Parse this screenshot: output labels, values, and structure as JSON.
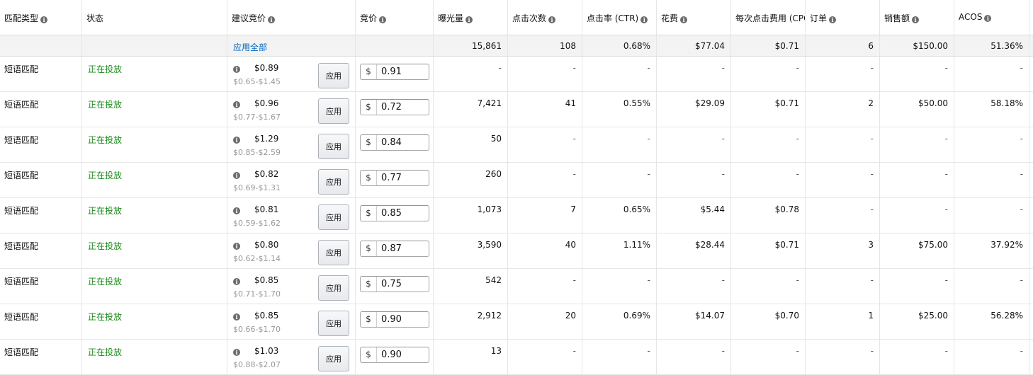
{
  "headers": {
    "match_type": "匹配类型",
    "status": "状态",
    "suggested_bid": "建议竞价",
    "bid": "竞价",
    "impressions": "曝光量",
    "clicks": "点击次数",
    "ctr": "点击率 (CTR)",
    "spend": "花费",
    "cpc": "每次点击费用 (CPC)",
    "orders": "订单",
    "sales": "销售额",
    "acos": "ACOS"
  },
  "summary": {
    "apply_all": "应用全部",
    "impressions": "15,861",
    "clicks": "108",
    "ctr": "0.68%",
    "spend": "$77.04",
    "cpc": "$0.71",
    "orders": "6",
    "sales": "$150.00",
    "acos": "51.36%"
  },
  "apply_label": "应用",
  "currency": "$",
  "rows": [
    {
      "match": "短语匹配",
      "status": "正在投放",
      "sugg": "$0.89",
      "range": "$0.65-$1.45",
      "bid": "0.91",
      "impressions": "-",
      "clicks": "-",
      "ctr": "-",
      "spend": "-",
      "cpc": "-",
      "orders": "-",
      "sales": "-",
      "acos": "-"
    },
    {
      "match": "短语匹配",
      "status": "正在投放",
      "sugg": "$0.96",
      "range": "$0.77-$1.67",
      "bid": "0.72",
      "impressions": "7,421",
      "clicks": "41",
      "ctr": "0.55%",
      "spend": "$29.09",
      "cpc": "$0.71",
      "orders": "2",
      "sales": "$50.00",
      "acos": "58.18%"
    },
    {
      "match": "短语匹配",
      "status": "正在投放",
      "sugg": "$1.29",
      "range": "$0.85-$2.59",
      "bid": "0.84",
      "impressions": "50",
      "clicks": "-",
      "ctr": "-",
      "spend": "-",
      "cpc": "-",
      "orders": "-",
      "sales": "-",
      "acos": "-"
    },
    {
      "match": "短语匹配",
      "status": "正在投放",
      "sugg": "$0.82",
      "range": "$0.69-$1.31",
      "bid": "0.77",
      "impressions": "260",
      "clicks": "-",
      "ctr": "-",
      "spend": "-",
      "cpc": "-",
      "orders": "-",
      "sales": "-",
      "acos": "-"
    },
    {
      "match": "短语匹配",
      "status": "正在投放",
      "sugg": "$0.81",
      "range": "$0.59-$1.62",
      "bid": "0.85",
      "impressions": "1,073",
      "clicks": "7",
      "ctr": "0.65%",
      "spend": "$5.44",
      "cpc": "$0.78",
      "orders": "-",
      "sales": "-",
      "acos": "-"
    },
    {
      "match": "短语匹配",
      "status": "正在投放",
      "sugg": "$0.80",
      "range": "$0.62-$1.14",
      "bid": "0.87",
      "impressions": "3,590",
      "clicks": "40",
      "ctr": "1.11%",
      "spend": "$28.44",
      "cpc": "$0.71",
      "orders": "3",
      "sales": "$75.00",
      "acos": "37.92%"
    },
    {
      "match": "短语匹配",
      "status": "正在投放",
      "sugg": "$0.85",
      "range": "$0.71-$1.70",
      "bid": "0.75",
      "impressions": "542",
      "clicks": "-",
      "ctr": "-",
      "spend": "-",
      "cpc": "-",
      "orders": "-",
      "sales": "-",
      "acos": "-"
    },
    {
      "match": "短语匹配",
      "status": "正在投放",
      "sugg": "$0.85",
      "range": "$0.66-$1.70",
      "bid": "0.90",
      "impressions": "2,912",
      "clicks": "20",
      "ctr": "0.69%",
      "spend": "$14.07",
      "cpc": "$0.70",
      "orders": "1",
      "sales": "$25.00",
      "acos": "56.28%"
    },
    {
      "match": "短语匹配",
      "status": "正在投放",
      "sugg": "$1.03",
      "range": "$0.88-$2.07",
      "bid": "0.90",
      "impressions": "13",
      "clicks": "-",
      "ctr": "-",
      "spend": "-",
      "cpc": "-",
      "orders": "-",
      "sales": "-",
      "acos": "-"
    }
  ]
}
